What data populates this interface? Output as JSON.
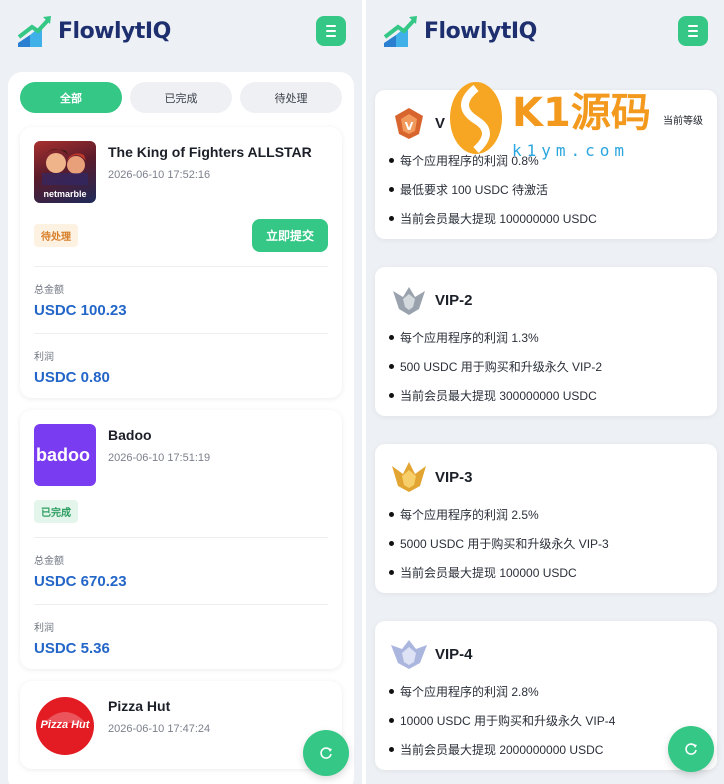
{
  "brand": {
    "name_part1": "Flowlyt",
    "name_part2": "IQ"
  },
  "tabs": [
    "全部",
    "已完成",
    "待处理"
  ],
  "orders": [
    {
      "app_name": "The King of Fighters ALLSTAR",
      "time": "2026-06-10 17:52:16",
      "image_caption": "netmarble",
      "status": "待处理",
      "action_label": "立即提交",
      "total_label": "总金额",
      "total_value": "USDC 100.23",
      "profit_label": "利润",
      "profit_value": "USDC 0.80"
    },
    {
      "app_name": "Badoo",
      "time": "2026-06-10 17:51:19",
      "image_caption": "badoo",
      "status": "已完成",
      "total_label": "总金额",
      "total_value": "USDC 670.23",
      "profit_label": "利润",
      "profit_value": "USDC 5.36"
    },
    {
      "app_name": "Pizza Hut",
      "time": "2026-06-10 17:47:24",
      "image_caption": "Pizza Hut"
    }
  ],
  "vip_levels": [
    {
      "name": "V",
      "current_label": "当前等级",
      "color": "#d8642e",
      "lines": [
        "每个应用程序的利润 0.8%",
        "最低要求 100 USDC 待激活",
        "当前会员最大提现 100000000 USDC"
      ]
    },
    {
      "name": "VIP-2",
      "color": "#9aa3ad",
      "lines": [
        "每个应用程序的利润 1.3%",
        "500 USDC 用于购买和升级永久 VIP-2",
        "当前会员最大提现 300000000 USDC"
      ]
    },
    {
      "name": "VIP-3",
      "color": "#e3a531",
      "lines": [
        "每个应用程序的利润 2.5%",
        "5000 USDC 用于购买和升级永久 VIP-3",
        "当前会员最大提现 100000 USDC"
      ]
    },
    {
      "name": "VIP-4",
      "color": "#aab6de",
      "lines": [
        "每个应用程序的利润 2.8%",
        "10000 USDC 用于购买和升级永久 VIP-4",
        "当前会员最大提现 2000000000 USDC"
      ]
    }
  ],
  "watermark": {
    "title": "K1源码",
    "url": "k1ym.com"
  },
  "colors": {
    "accent": "#34c786",
    "link_blue": "#2366c8",
    "brand_navy": "#1d2f6f"
  },
  "icons": {
    "menu": "hamburger-menu-icon",
    "support": "support-refresh-icon"
  }
}
